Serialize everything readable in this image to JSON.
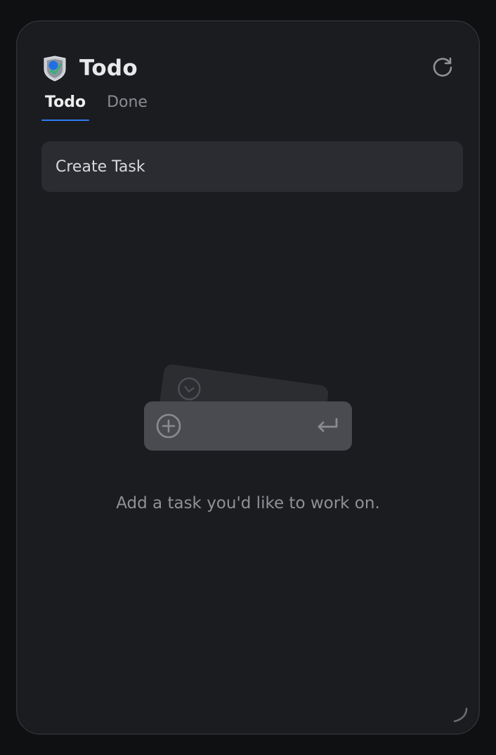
{
  "header": {
    "title": "Todo",
    "app_icon": "todo-shield-icon",
    "refresh_icon": "refresh-icon"
  },
  "tabs": [
    {
      "label": "Todo",
      "active": true
    },
    {
      "label": "Done",
      "active": false
    }
  ],
  "create_task": {
    "placeholder": "Create Task",
    "value": ""
  },
  "empty_state": {
    "message": "Add a task you'd like to work on.",
    "illustration_icons": [
      "check-circle-icon",
      "plus-circle-icon",
      "enter-key-icon"
    ]
  },
  "colors": {
    "background": "#1b1c1f",
    "accent": "#2f7cf6",
    "input_bg": "#2a2c31"
  }
}
